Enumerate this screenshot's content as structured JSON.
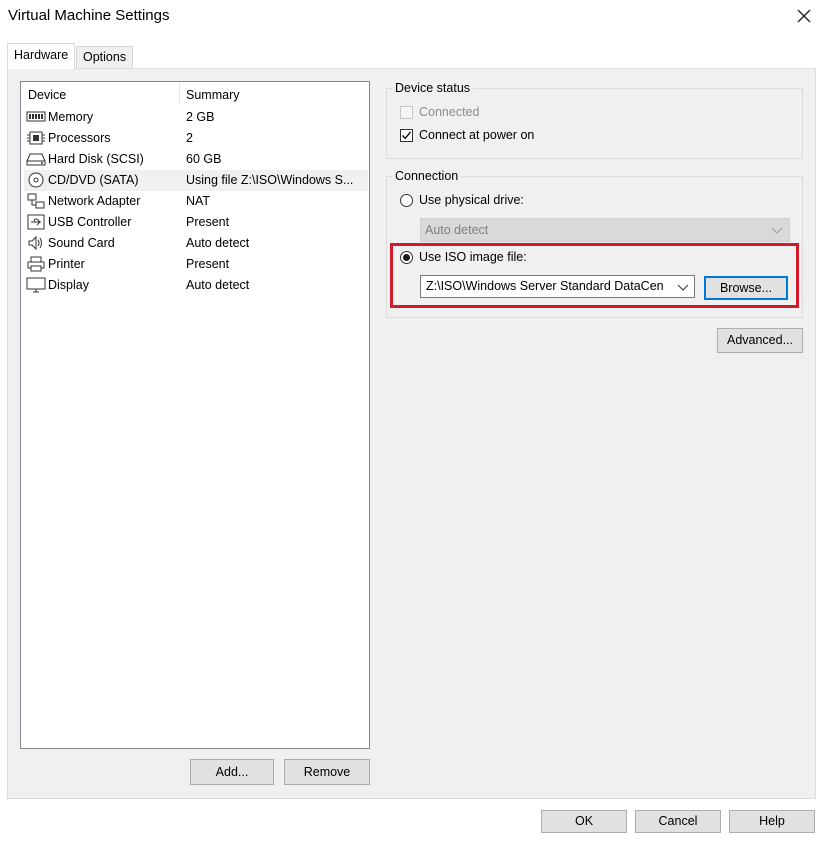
{
  "window": {
    "title": "Virtual Machine Settings",
    "close_icon": "close-icon"
  },
  "tabs": [
    {
      "label": "Hardware",
      "active": true
    },
    {
      "label": "Options",
      "active": false
    }
  ],
  "device_list": {
    "headers": {
      "device": "Device",
      "summary": "Summary"
    },
    "selected": "CD/DVD (SATA)",
    "rows": [
      {
        "icon": "memory-icon",
        "device": "Memory",
        "summary": "2 GB"
      },
      {
        "icon": "processor-icon",
        "device": "Processors",
        "summary": "2"
      },
      {
        "icon": "hard-disk-icon",
        "device": "Hard Disk (SCSI)",
        "summary": "60 GB"
      },
      {
        "icon": "cd-dvd-icon",
        "device": "CD/DVD (SATA)",
        "summary": "Using file Z:\\ISO\\Windows S..."
      },
      {
        "icon": "network-adapter-icon",
        "device": "Network Adapter",
        "summary": "NAT"
      },
      {
        "icon": "usb-icon",
        "device": "USB Controller",
        "summary": "Present"
      },
      {
        "icon": "sound-icon",
        "device": "Sound Card",
        "summary": "Auto detect"
      },
      {
        "icon": "printer-icon",
        "device": "Printer",
        "summary": "Present"
      },
      {
        "icon": "display-icon",
        "device": "Display",
        "summary": "Auto detect"
      }
    ],
    "add_button": "Add...",
    "remove_button": "Remove"
  },
  "device_status": {
    "label": "Device status",
    "connected": {
      "label": "Connected",
      "checked": false,
      "enabled": false
    },
    "connect_at_power_on": {
      "label": "Connect at power on",
      "checked": true,
      "enabled": true
    }
  },
  "connection": {
    "label": "Connection",
    "use_physical_drive": {
      "label": "Use physical drive:",
      "selected": false
    },
    "physical_drive_select": {
      "value": "Auto detect",
      "enabled": false
    },
    "use_iso_image": {
      "label": "Use ISO image file:",
      "selected": true
    },
    "iso_path": {
      "value": "Z:\\ISO\\Windows Server Standard DataCen"
    },
    "browse_button": "Browse...",
    "highlight_color": "#d11a2a"
  },
  "advanced_button": "Advanced...",
  "footer": {
    "ok": "OK",
    "cancel": "Cancel",
    "help": "Help"
  },
  "colors": {
    "panel_bg": "#f0f0f0",
    "focus_blue": "#0078d7",
    "highlight_red": "#d11a2a"
  }
}
